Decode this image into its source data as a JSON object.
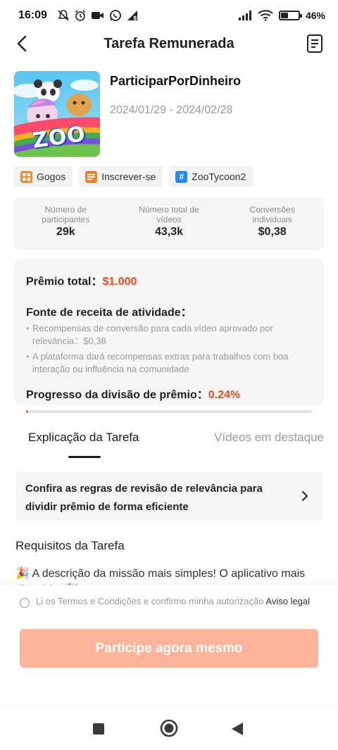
{
  "status_bar": {
    "time": "16:09",
    "battery_percent": "46%",
    "battery_level": 0.46
  },
  "header": {
    "title": "Tarefa Remunerada"
  },
  "task": {
    "name": "ParticiparPorDinheiro",
    "dates": "2024/01/29 - 2024/02/28",
    "thumbnail_text": "ZOO"
  },
  "tags": [
    {
      "label": "Gogos",
      "icon": "grid-icon",
      "color": "#ff8a1f"
    },
    {
      "label": "Inscrever-se",
      "icon": "list-icon",
      "color": "#ff7a1a"
    },
    {
      "label": "ZooTycoon2",
      "icon": "hashtag-icon",
      "color": "#1e8bff"
    }
  ],
  "stats": [
    {
      "label": "Número de participantes",
      "value": "29k"
    },
    {
      "label": "Número total de vídeos",
      "value": "43,3k"
    },
    {
      "label": "Conversões individuais",
      "value": "$0,38"
    }
  ],
  "prize": {
    "total_label": "Prêmio total：",
    "total_value": "$1.000",
    "source_title": "Fonte de receita de atividade：",
    "bullets": [
      "Recompensas de conversão para cada vídeo aprovado por relevância：$0,38",
      "A plataforma dará recompensas extras para trabalhos com boa interação ou influência na comunidade"
    ],
    "progress_label": "Progresso da divisão de prêmio：",
    "progress_value": "0.24%",
    "progress_fraction": 0.0024
  },
  "tabs": [
    {
      "label": "Explicação da Tarefa",
      "active": true
    },
    {
      "label": "Vídeos em destaque",
      "active": false
    }
  ],
  "rules_card": {
    "text": "Confira as regras de revisão de relevância para dividir prêmio de forma eficiente"
  },
  "requirements": {
    "title": "Requisitos da Tarefa",
    "description": "🎉 A descrição da missão mais simples! O aplicativo mais divertido! 🎉"
  },
  "footer": {
    "terms_text": "Li os Termos e Condições e confirmo minha autorização",
    "terms_link": "Aviso legal",
    "cta_label": "Participe agora mesmo"
  }
}
